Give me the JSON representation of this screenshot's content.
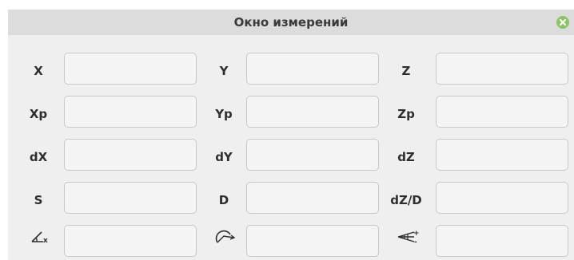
{
  "window": {
    "title": "Окно измерений",
    "accent_close": "#8fc26a"
  },
  "rows": [
    [
      {
        "label": "X",
        "value": ""
      },
      {
        "label": "Y",
        "value": ""
      },
      {
        "label": "Z",
        "value": ""
      }
    ],
    [
      {
        "label": "Xp",
        "value": ""
      },
      {
        "label": "Yp",
        "value": ""
      },
      {
        "label": "Zp",
        "value": ""
      }
    ],
    [
      {
        "label": "dX",
        "value": ""
      },
      {
        "label": "dY",
        "value": ""
      },
      {
        "label": "dZ",
        "value": ""
      }
    ],
    [
      {
        "label": "S",
        "value": ""
      },
      {
        "label": "D",
        "value": ""
      },
      {
        "label": "dZ/D",
        "value": ""
      }
    ],
    [
      {
        "icon": "angle-x-icon",
        "value": ""
      },
      {
        "icon": "direction-angle-icon",
        "value": ""
      },
      {
        "icon": "slope-angle-icon",
        "value": ""
      }
    ]
  ]
}
